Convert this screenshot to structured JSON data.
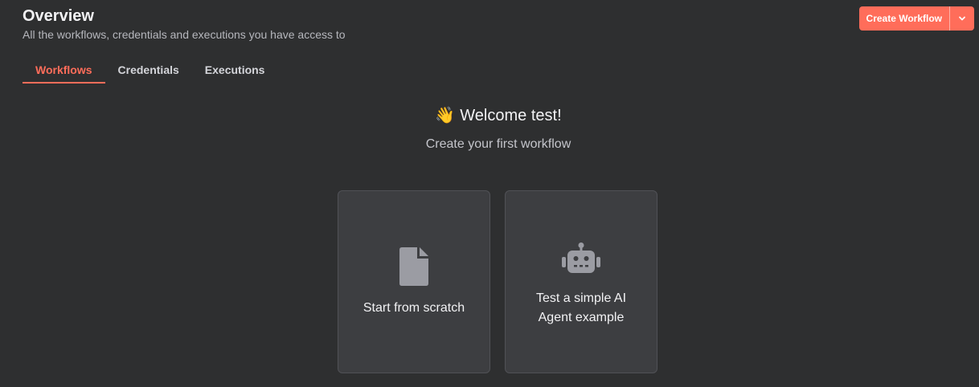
{
  "header": {
    "title": "Overview",
    "subtitle": "All the workflows, credentials and executions you have access to"
  },
  "actions": {
    "create_label": "Create Workflow",
    "dropdown_icon": "chevron-down-icon"
  },
  "tabs": [
    {
      "label": "Workflows",
      "active": true
    },
    {
      "label": "Credentials",
      "active": false
    },
    {
      "label": "Executions",
      "active": false
    }
  ],
  "welcome": {
    "emoji": "👋",
    "title": "Welcome test!",
    "subtitle": "Create your first workflow"
  },
  "cards": [
    {
      "label": "Start from scratch",
      "icon": "file-icon"
    },
    {
      "label": "Test a simple AI Agent example",
      "icon": "robot-icon"
    }
  ],
  "colors": {
    "accent": "#ff6d5a",
    "background": "#2e2f30",
    "card": "#3d3e41"
  }
}
